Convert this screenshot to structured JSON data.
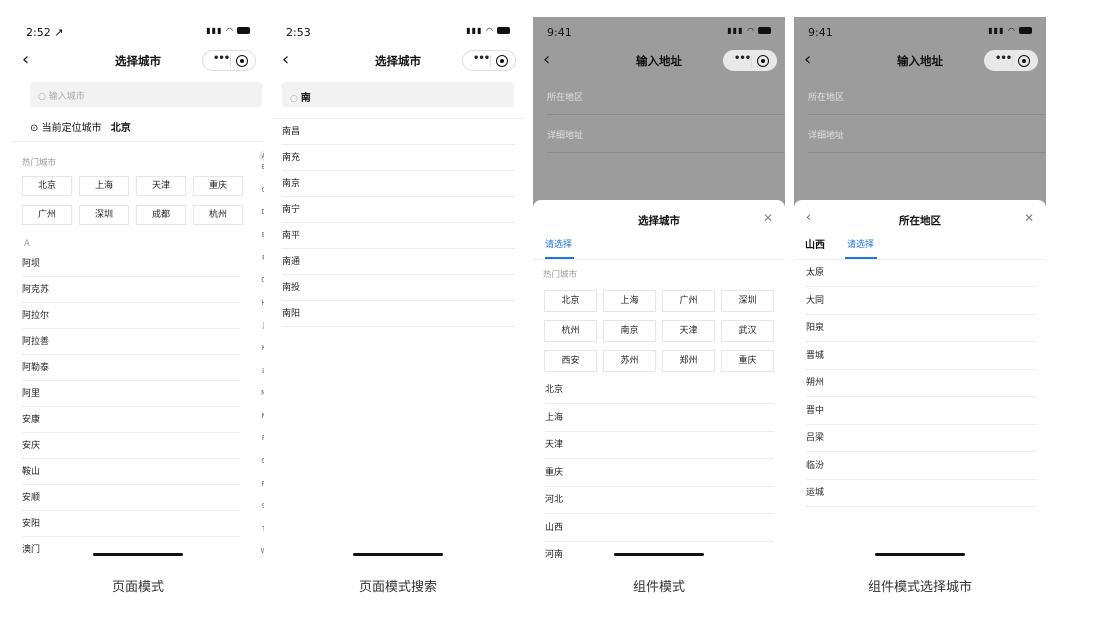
{
  "screens": [
    {
      "caption": "页面模式",
      "status": {
        "time": "2:52 ↗"
      },
      "nav_title": "选择城市",
      "search_placeholder": "输入城市",
      "location_label": "当前定位城市",
      "location_city": "北京",
      "hot_title": "热门城市",
      "hot_cities": [
        "北京",
        "上海",
        "天津",
        "重庆",
        "广州",
        "深圳",
        "成都",
        "杭州"
      ],
      "section_letter": "A",
      "cities": [
        "阿坝",
        "阿克苏",
        "阿拉尔",
        "阿拉善",
        "阿勒泰",
        "阿里",
        "安康",
        "安庆",
        "鞍山",
        "安顺",
        "安阳",
        "澳门"
      ],
      "index_letters": [
        "A",
        "B",
        "C",
        "D",
        "E",
        "F",
        "G",
        "H",
        "J",
        "K",
        "L",
        "M",
        "N",
        "P",
        "Q",
        "R",
        "S",
        "T",
        "W",
        "X",
        "Y",
        "Z"
      ]
    },
    {
      "caption": "页面模式搜索",
      "status": {
        "time": "2:53"
      },
      "nav_title": "选择城市",
      "search_query": "南",
      "results": [
        "南昌",
        "南充",
        "南京",
        "南宁",
        "南平",
        "南通",
        "南投",
        "南阳"
      ]
    },
    {
      "caption": "组件模式",
      "status": {
        "time": "9:41"
      },
      "nav_title": "输入地址",
      "fields": [
        "所在地区",
        "详细地址"
      ],
      "sheet_title": "选择城市",
      "tab_active": "请选择",
      "hot_title": "热门城市",
      "hot_cities": [
        "北京",
        "上海",
        "广州",
        "深圳",
        "杭州",
        "南京",
        "天津",
        "武汉",
        "西安",
        "苏州",
        "郑州",
        "重庆"
      ],
      "provinces": [
        "北京",
        "上海",
        "天津",
        "重庆",
        "河北",
        "山西",
        "河南"
      ]
    },
    {
      "caption": "组件模式选择城市",
      "status": {
        "time": "9:41"
      },
      "nav_title": "输入地址",
      "fields": [
        "所在地区",
        "详细地址"
      ],
      "sheet_title": "所在地区",
      "tab_done": "山西",
      "tab_active": "请选择",
      "cities": [
        "太原",
        "大同",
        "阳泉",
        "晋城",
        "朔州",
        "晋中",
        "吕梁",
        "临汾",
        "运城"
      ]
    }
  ]
}
